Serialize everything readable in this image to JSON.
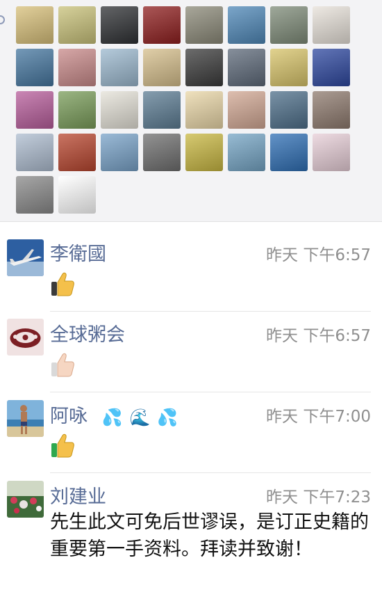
{
  "likes": {
    "icon": "heart-outline-icon",
    "avatars": [
      {
        "name": "avatar-man-yellow-tie",
        "bg": "#d8c07a"
      },
      {
        "name": "avatar-fruit-bowl",
        "bg": "#c9c27a"
      },
      {
        "name": "avatar-dark-silhouette",
        "bg": "#2f3134"
      },
      {
        "name": "avatar-red-flowers-sign",
        "bg": "#8f1f1f"
      },
      {
        "name": "avatar-pagoda",
        "bg": "#8c8a79"
      },
      {
        "name": "avatar-man-beach",
        "bg": "#4f88b8"
      },
      {
        "name": "avatar-man-outdoors",
        "bg": "#7f8c79"
      },
      {
        "name": "avatar-woman-portrait",
        "bg": "#e8e2da"
      },
      {
        "name": "avatar-sea-horizon",
        "bg": "#4677a0"
      },
      {
        "name": "avatar-peony-painting",
        "bg": "#c98a8a"
      },
      {
        "name": "avatar-cyclist",
        "bg": "#9cb9cf"
      },
      {
        "name": "avatar-golden-phoenix",
        "bg": "#d6bf8c"
      },
      {
        "name": "avatar-man-dark-scene",
        "bg": "#3b3b3b"
      },
      {
        "name": "avatar-man-suit",
        "bg": "#5e6a7a"
      },
      {
        "name": "avatar-patterned-tile",
        "bg": "#d8c46a"
      },
      {
        "name": "avatar-singer-stage",
        "bg": "#2e48a0"
      },
      {
        "name": "avatar-woman-flowers",
        "bg": "#b85e9c"
      },
      {
        "name": "avatar-golf-course",
        "bg": "#7a9d5a"
      },
      {
        "name": "avatar-calligraphy",
        "bg": "#e5e2d8"
      },
      {
        "name": "avatar-white-flower",
        "bg": "#5d7d94"
      },
      {
        "name": "avatar-gold-coin",
        "bg": "#ead7a8"
      },
      {
        "name": "avatar-woman-red",
        "bg": "#d2a894"
      },
      {
        "name": "avatar-wave-art",
        "bg": "#4e6f8a"
      },
      {
        "name": "avatar-misty-landscape",
        "bg": "#8f7b6f"
      },
      {
        "name": "avatar-blue-porcelain",
        "bg": "#aebdd0"
      },
      {
        "name": "avatar-award-man",
        "bg": "#b8462f"
      },
      {
        "name": "avatar-flying-bird",
        "bg": "#79a3c9"
      },
      {
        "name": "avatar-man-black-white",
        "bg": "#6f6f6f"
      },
      {
        "name": "avatar-yellow-field",
        "bg": "#c9b842"
      },
      {
        "name": "avatar-lotus",
        "bg": "#75a5c5"
      },
      {
        "name": "avatar-ocean-blue",
        "bg": "#2f6fb5"
      },
      {
        "name": "avatar-cartoon-girl",
        "bg": "#e8cfd8"
      },
      {
        "name": "avatar-grey-flowers",
        "bg": "#8a8a8a"
      },
      {
        "name": "avatar-calligraphy-love",
        "bg": "#ffffff"
      }
    ]
  },
  "comments": [
    {
      "name": "李衛國",
      "time": "昨天  下午6:57",
      "emoji": "👍",
      "avatar_name": "avatar-airbus-plane"
    },
    {
      "name": "全球粥会",
      "time": "昨天  下午6:57",
      "emoji": "👍🏻",
      "avatar_name": "avatar-cloud-logo"
    },
    {
      "name": "阿咏",
      "name_emojis": [
        "💦",
        "🌊",
        "💦"
      ],
      "time": "昨天  下午7:00",
      "emoji": "👍",
      "avatar_name": "avatar-man-seaside"
    },
    {
      "name": "刘建业",
      "time": "昨天  下午7:23",
      "text": "先生此文可免后世谬误，是订正史籍的重要第一手资料。拜读并致谢！",
      "avatar_name": "avatar-flower-garden"
    }
  ]
}
